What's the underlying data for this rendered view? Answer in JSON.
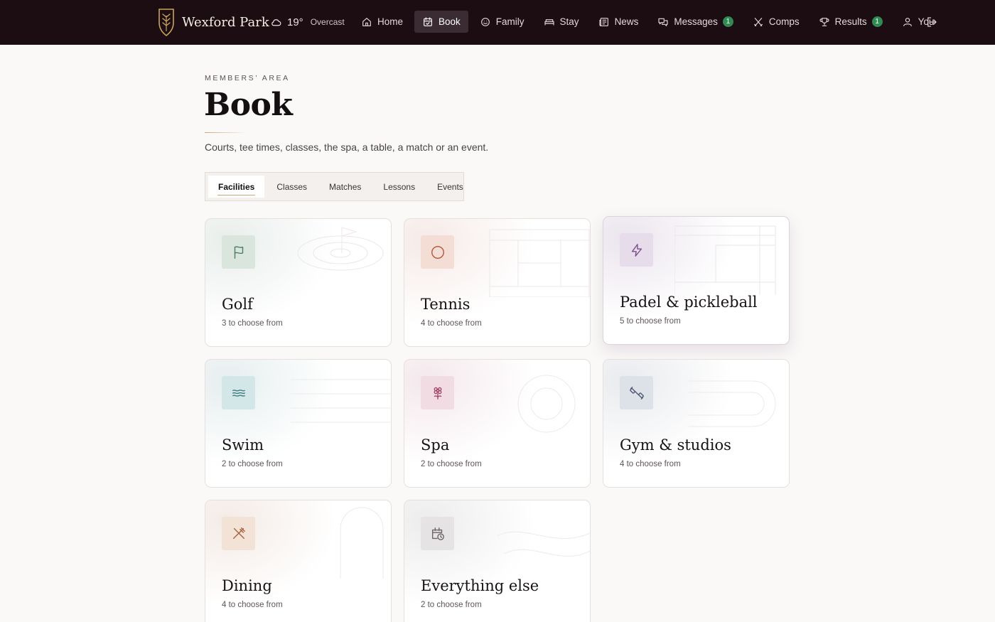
{
  "app": {
    "name": "Wexford Park"
  },
  "weather": {
    "temperature": "19°",
    "condition": "Overcast"
  },
  "nav": {
    "items": [
      {
        "label": "Home",
        "icon": "home-icon"
      },
      {
        "label": "Book",
        "icon": "calendar-icon",
        "active": true
      },
      {
        "label": "Family",
        "icon": "smile-icon"
      },
      {
        "label": "Stay",
        "icon": "bed-icon"
      },
      {
        "label": "News",
        "icon": "newspaper-icon"
      },
      {
        "label": "Messages",
        "icon": "chat-icon",
        "badge": "1"
      },
      {
        "label": "Comps",
        "icon": "crossed-clubs-icon"
      },
      {
        "label": "Results",
        "icon": "trophy-icon",
        "badge": "1"
      },
      {
        "label": "You",
        "icon": "user-icon"
      }
    ],
    "logout_icon": "logout-icon"
  },
  "header": {
    "kicker": "MEMBERS’ AREA",
    "title": "Book",
    "subtitle": "Courts, tee times, classes, the spa, a table, a match or an event."
  },
  "tabs": [
    {
      "label": "Facilities",
      "active": true
    },
    {
      "label": "Classes"
    },
    {
      "label": "Matches"
    },
    {
      "label": "Lessons"
    },
    {
      "label": "Events"
    }
  ],
  "facilities": [
    {
      "title": "Golf",
      "subtitle": "3 to choose from",
      "icon": "flag-icon",
      "accent": "#4f7a62"
    },
    {
      "title": "Tennis",
      "subtitle": "4 to choose from",
      "icon": "ball-icon",
      "accent": "#b0553a"
    },
    {
      "title": "Padel & pickleball",
      "subtitle": "5 to choose from",
      "icon": "lightning-icon",
      "accent": "#7a4f8a"
    },
    {
      "title": "Swim",
      "subtitle": "2 to choose from",
      "icon": "waves-icon",
      "accent": "#3f7b82"
    },
    {
      "title": "Spa",
      "subtitle": "2 to choose from",
      "icon": "flower-icon",
      "accent": "#a3456a"
    },
    {
      "title": "Gym & studios",
      "subtitle": "4 to choose from",
      "icon": "dumbbell-icon",
      "accent": "#4e5a73"
    },
    {
      "title": "Dining",
      "subtitle": "4 to choose from",
      "icon": "utensils-icon",
      "accent": "#a8643e"
    },
    {
      "title": "Everything else",
      "subtitle": "2 to choose from",
      "icon": "calendar-clock-icon",
      "accent": "#6b6468"
    }
  ]
}
